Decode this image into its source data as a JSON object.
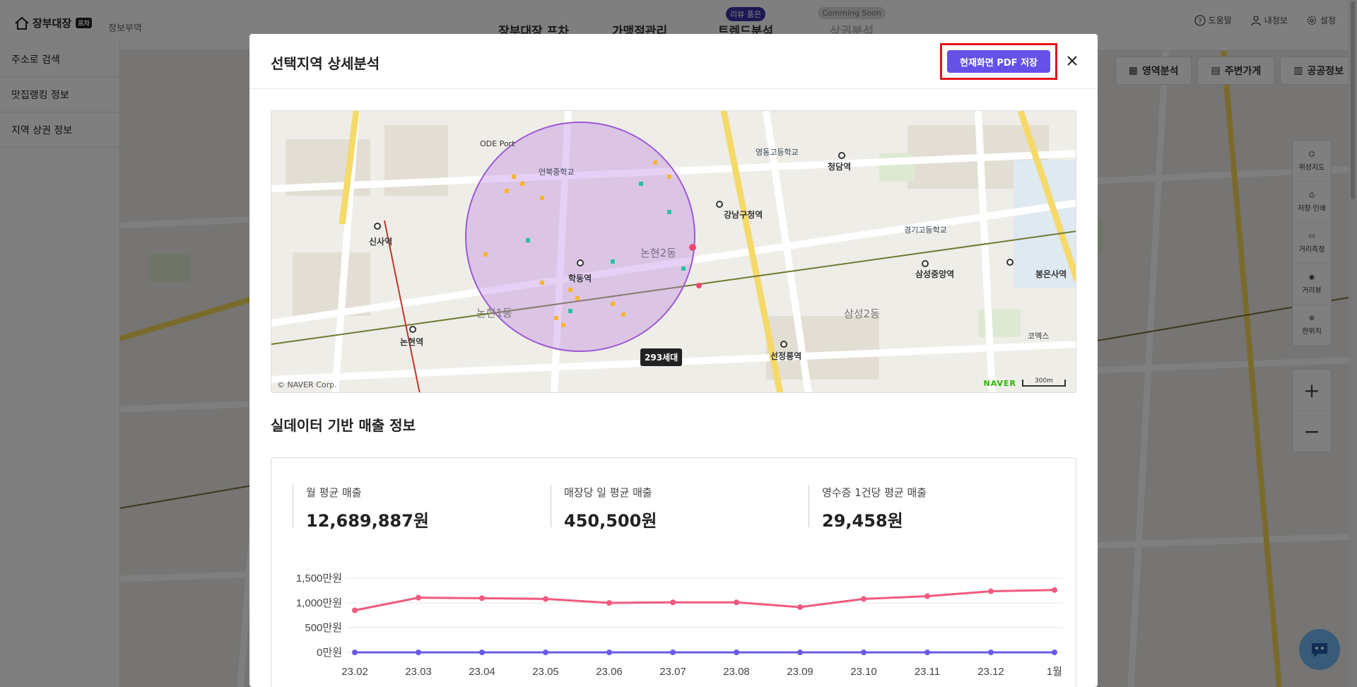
{
  "header": {
    "logo_text": "장부대장",
    "logo_badge": "프차",
    "business": "정보부역",
    "nav": [
      {
        "label": "장부대장 프차",
        "tag": ""
      },
      {
        "label": "가맹점관리",
        "tag": ""
      },
      {
        "label": "트렌드분석",
        "tag": "리뷰 품은"
      },
      {
        "label": "상권분석",
        "tag": "Comming Soon"
      }
    ],
    "utils": [
      "도움말",
      "내정보",
      "설정"
    ]
  },
  "sidebar": {
    "items": [
      "주소로 검색",
      "맛집랭킹 정보",
      "지역 상권 정보"
    ]
  },
  "map_tabs": [
    "영역분석",
    "주변가게",
    "공공정보"
  ],
  "map_tools": [
    "위성지도",
    "저장·인쇄",
    "거리측정",
    "거리뷰",
    "현위치"
  ],
  "zoom": {
    "in": "+",
    "out": "−"
  },
  "modal": {
    "title": "선택지역 상세분석",
    "pdf_button": "현재화면 PDF 저장",
    "map": {
      "copyright": "© NAVER Corp.",
      "naver": "NAVER",
      "scale": "300m",
      "households": "293세대",
      "places": [
        {
          "name": "신사역"
        },
        {
          "name": "학동역"
        },
        {
          "name": "논현역"
        },
        {
          "name": "논현2동"
        },
        {
          "name": "논현1동"
        },
        {
          "name": "강남구청역"
        },
        {
          "name": "청담역"
        },
        {
          "name": "삼성중앙역"
        },
        {
          "name": "선정릉역"
        },
        {
          "name": "봉은사역"
        },
        {
          "name": "삼성2동"
        },
        {
          "name": "영동고등학교"
        },
        {
          "name": "경기고등학교"
        },
        {
          "name": "언북중학교"
        },
        {
          "name": "코엑스"
        },
        {
          "name": "ODE Port"
        }
      ]
    },
    "section_title": "실데이터 기반 매출 정보",
    "stats": [
      {
        "label": "월 평균 매출",
        "value": "12,689,887원"
      },
      {
        "label": "매장당 일 평균 매출",
        "value": "450,500원"
      },
      {
        "label": "영수증 1건당 평균 매출",
        "value": "29,458원"
      }
    ]
  },
  "chart_data": {
    "type": "line",
    "categories": [
      "23.02",
      "23.03",
      "23.04",
      "23.05",
      "23.06",
      "23.07",
      "23.08",
      "23.09",
      "23.10",
      "23.11",
      "23.12",
      "1월"
    ],
    "y_ticks": [
      "0만원",
      "500만원",
      "1,000만원",
      "1,500만원"
    ],
    "ylim": [
      0,
      1500
    ],
    "series": [
      {
        "name": "",
        "color": "#f05a7e",
        "values": [
          850,
          1105,
          1095,
          1080,
          1000,
          1010,
          1010,
          915,
          1080,
          1135,
          1235,
          1260
        ]
      },
      {
        "name": "",
        "color": "#6a5be6",
        "values": [
          0,
          0,
          0,
          0,
          0,
          0,
          0,
          0,
          0,
          0,
          0,
          0
        ]
      }
    ],
    "grid": true
  },
  "colors": {
    "accent": "#6651e8",
    "highlight": "#e3141b",
    "circle": "#9b59d6"
  }
}
